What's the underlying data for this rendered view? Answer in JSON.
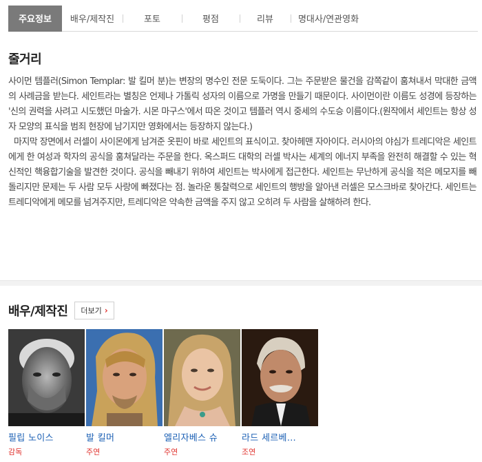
{
  "tabs": [
    {
      "label": "주요정보",
      "active": true
    },
    {
      "label": "배우/제작진",
      "active": false
    },
    {
      "label": "포토",
      "active": false
    },
    {
      "label": "평점",
      "active": false
    },
    {
      "label": "리뷰",
      "active": false
    },
    {
      "label": "명대사/연관영화",
      "active": false
    }
  ],
  "synopsis": {
    "title": "줄거리",
    "paragraph1": "사이먼 템플러(Simon Templar: 발 킬머 분)는 변장의 명수인 전문 도둑이다. 그는 주문받은 물건을 감쪽같이 훔쳐내서 막대한 금액의 사례금을 받는다. 세인트라는 별칭은 언제나 가톨릭 성자의 이름으로 가명을 만들기 때문이다. 사이먼이란 이름도 성경에 등장하는 '신의 권력을 사려고 시도했던 마술가. 시몬 마구스'에서 따온 것이고 템플러 역시 중세의 수도승 이름이다.(원작에서 세인트는 항상 성자 모양의 표식을 범죄 현장에 남기지만 영화에서는 등장하지 않는다.)",
    "paragraph2": "마지막 장면에서 러셀이 사이몬에게 남겨준 옷핀이 바로 세인트의 표식이고. 찾아헤맨 자아이다. 러시아의 야심가 트레디악은 세인트에게 한 여성과 학자의 공식을 훔쳐달라는 주문을 한다. 옥스퍼드 대학의 러셀 박사는 세계의 에너지 부족을 완전히 해결할 수 있는 혁신적인 핵융합기술을 발견한 것이다. 공식을 빼내기 위하여 세인트는 박사에게 접근한다. 세인트는 무난하게 공식을 적은 메모지를 빼돌리지만 문제는 두 사람 모두 사랑에 빠졌다는 점. 놀라운 통찰력으로 세인트의 행방을 알아낸 러셀은 모스크바로 찾아간다. 세인트는 트레디악에게 메모를 넘겨주지만, 트레디악은 약속한 금액을 주지 않고 오히려 두 사람을 살해하려 한다."
  },
  "cast_section": {
    "title": "배우/제작진",
    "more_label": "더보기",
    "more_icon": "chevron-right-icon"
  },
  "cast": [
    {
      "name": "필립 노이스",
      "role": "감독"
    },
    {
      "name": "발 킬머",
      "role": "주연"
    },
    {
      "name": "엘리자베스 슈",
      "role": "주연"
    },
    {
      "name": "라드 세르베…",
      "role": "조연"
    }
  ],
  "colors": {
    "tab_active_bg": "#7a7a7a",
    "link_blue": "#1a5fb4",
    "role_red": "#e0342f"
  }
}
